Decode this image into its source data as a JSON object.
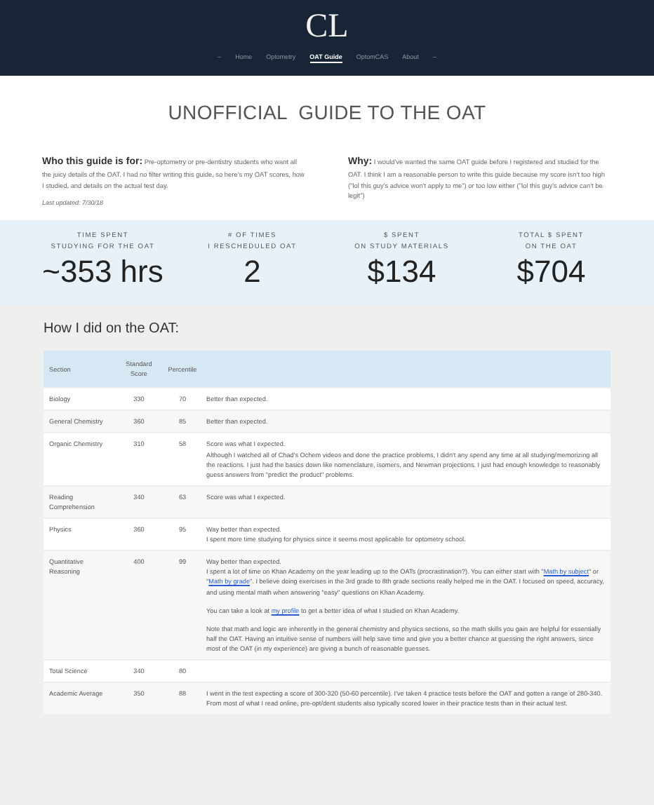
{
  "header": {
    "logo": "CL",
    "nav_left": "–",
    "nav": [
      {
        "label": "Home",
        "selected": false
      },
      {
        "label": "Optometry",
        "selected": false
      },
      {
        "label": "OAT Guide",
        "selected": true
      },
      {
        "label": "OptomCAS",
        "selected": false
      },
      {
        "label": "About",
        "selected": false
      }
    ],
    "nav_right": "–"
  },
  "page_title": "UNOFFICIAL  GUIDE TO THE OAT",
  "intro": {
    "left": "**Who this guide is for:** Pre-optometry or pre-dentistry students who want all the juicy details of the OAT. I had no filter writing this guide, so here's my OAT scores, how I studied, and details on the actual test day.",
    "last_updated": "Last updated: 7/30/18",
    "right": "**Why:** I would've wanted the same OAT guide before I registered and studied for the OAT. I think I am a reasonable person to write this guide because my score isn't too high (\"lol this guy's advice won't apply to me\") or too low either (\"lol this guy's advice can't be legit\")"
  },
  "stats": [
    {
      "label_lines": [
        "TIME SPENT",
        "STUDYING FOR THE OAT"
      ],
      "value": "~353 hrs"
    },
    {
      "label_lines": [
        "# OF TIMES",
        "I RESCHEDULED OAT"
      ],
      "value": "2"
    },
    {
      "label_lines": [
        "$ SPENT",
        "ON STUDY MATERIALS"
      ],
      "value": "$134"
    },
    {
      "label_lines": [
        "TOTAL $ SPENT",
        "ON THE OAT"
      ],
      "value": "$704"
    }
  ],
  "scores": {
    "heading": "How I did on the OAT:",
    "columns": [
      "Section",
      "Standard Score",
      "Percentile"
    ],
    "rows": [
      {
        "section": "Biology",
        "score": "330",
        "percentile": "70",
        "notes": [
          [
            "Better than expected."
          ]
        ]
      },
      {
        "section": "General Chemistry",
        "score": "360",
        "percentile": "85",
        "notes": [
          [
            "Better than expected."
          ]
        ]
      },
      {
        "section": "Organic Chemistry",
        "score": "310",
        "percentile": "58",
        "notes": [
          [
            "Score was what I expected.",
            "Although I watched all of Chad's Ochem videos and done the practice problems, I didn't any spend any time at all studying/memorizing all the reactions. I just had the basics down like nomenclature, isomers, and Newman projections. I just had enough knowledge to reasonably guess answers from \"predict the product\" problems."
          ]
        ]
      },
      {
        "section": "Reading Comprehension",
        "score": "340",
        "percentile": "63",
        "notes": [
          [
            "Score was what I expected."
          ]
        ]
      },
      {
        "section": "Physics",
        "score": "360",
        "percentile": "95",
        "notes": [
          [
            "Way better than expected.",
            "I spent more time studying for physics since it seems most applicable for optometry school."
          ]
        ]
      },
      {
        "section": "Quantitative Reasoning",
        "score": "400",
        "percentile": "99",
        "notes": [
          [
            "Way better than expected.",
            [
              {
                "text": "I spent a lot of time on Khan Academy on the year leading up to the OATs (procrastination?). You can either start with \"",
                "link": false
              },
              {
                "text": "Math by subject",
                "link": true
              },
              {
                "text": "\" or \"",
                "link": false
              },
              {
                "text": "Math by grade",
                "link": true
              },
              {
                "text": "\". I believe doing exercises in the 3rd grade to 8th grade sections really helped me in the OAT. I focused on speed, accuracy, and using mental math when answering \"easy\" questions on Khan Academy.",
                "link": false
              }
            ]
          ],
          [
            [
              {
                "text": "You can take a look at ",
                "link": false
              },
              {
                "text": "my profile",
                "link": true
              },
              {
                "text": " to get a better idea of what I studied on Khan Academy.",
                "link": false
              }
            ]
          ],
          [
            "Note that math and logic are inherently in the general chemistry and physics sections, so the math skills you gain are helpful for essentially half the OAT. Having an intuitive sense of numbers will help save time and give you a better chance at guessing the right answers, since most of the OAT (in my experience) are giving a bunch of reasonable guesses."
          ]
        ]
      },
      {
        "section": "Total Science",
        "score": "340",
        "percentile": "80",
        "notes": []
      },
      {
        "section": "Academic Average",
        "score": "350",
        "percentile": "88",
        "notes": [
          [
            "I went in the test expecting a score of 300-320 (50-60 percentile). I've taken 4 practice tests before the OAT and gotten a range of 280-340. From most of what I read online, pre-opt/dent students also typically scored lower in their practice tests than in their actual test."
          ]
        ]
      }
    ]
  }
}
